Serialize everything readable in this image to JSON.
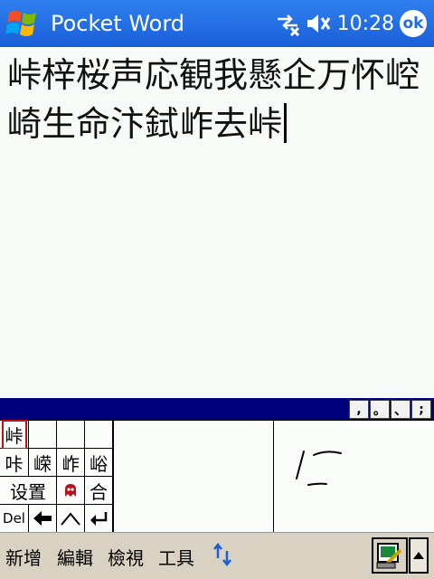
{
  "titlebar": {
    "app_title": "Pocket Word",
    "time": "10:28",
    "ok_label": "ok",
    "icons": [
      "windows-start-icon",
      "connectivity-icon",
      "volume-icon"
    ]
  },
  "document": {
    "text": "峠梓桜声応観我懸企万怀崆崎生命汴鉽岞去峠"
  },
  "ime": {
    "punctuation": [
      ",",
      "。",
      "、",
      ";"
    ],
    "candidates": {
      "row1": [
        "峠",
        "",
        "",
        ""
      ],
      "row2": [
        "咔",
        "嵘",
        "岞",
        "峪"
      ],
      "row3_settings": "设置",
      "row3_last": "合",
      "row4_del": "Del"
    }
  },
  "menubar": {
    "items": [
      "新增",
      "編輯",
      "檢視",
      "工具"
    ]
  },
  "colors": {
    "titlebar": "#1f6de0",
    "ime_bar": "#00007c",
    "menubar": "#d9d2c2"
  }
}
